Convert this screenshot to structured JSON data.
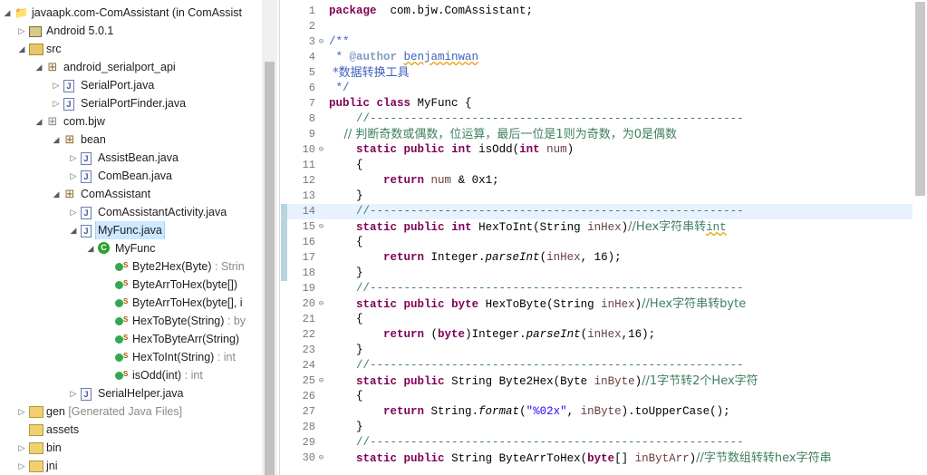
{
  "explorer": {
    "items": [
      {
        "label": "javaapk.com-ComAssistant (in ComAssist",
        "sig": "",
        "depth": 0,
        "toggle": "open",
        "icon": "project-icon"
      },
      {
        "label": "Android 5.0.1",
        "sig": "",
        "depth": 1,
        "toggle": "closed",
        "icon": "library-icon"
      },
      {
        "label": "src",
        "sig": "",
        "depth": 1,
        "toggle": "open",
        "icon": "source-folder-icon"
      },
      {
        "label": "android_serialport_api",
        "sig": "",
        "depth": 2,
        "toggle": "open",
        "icon": "package-icon"
      },
      {
        "label": "SerialPort.java",
        "sig": "",
        "depth": 3,
        "toggle": "closed",
        "icon": "java-file-icon"
      },
      {
        "label": "SerialPortFinder.java",
        "sig": "",
        "depth": 3,
        "toggle": "closed",
        "icon": "java-file-icon"
      },
      {
        "label": "com.bjw",
        "sig": "",
        "depth": 2,
        "toggle": "open",
        "icon": "empty-package-icon"
      },
      {
        "label": "bean",
        "sig": "",
        "depth": 2,
        "toggle": "open",
        "icon": "package-icon",
        "indent": 1
      },
      {
        "label": "AssistBean.java",
        "sig": "",
        "depth": 3,
        "toggle": "closed",
        "icon": "java-file-icon",
        "indent": 1
      },
      {
        "label": "ComBean.java",
        "sig": "",
        "depth": 3,
        "toggle": "closed",
        "icon": "java-file-icon",
        "indent": 1
      },
      {
        "label": "ComAssistant",
        "sig": "",
        "depth": 2,
        "toggle": "open",
        "icon": "package-icon",
        "indent": 1
      },
      {
        "label": "ComAssistantActivity.java",
        "sig": "",
        "depth": 3,
        "toggle": "closed",
        "icon": "java-file-icon",
        "indent": 1
      },
      {
        "label": "MyFunc.java",
        "sig": "",
        "depth": 3,
        "toggle": "open",
        "icon": "java-file-icon",
        "indent": 1,
        "selected": true
      },
      {
        "label": "MyFunc",
        "sig": "",
        "depth": 4,
        "toggle": "open",
        "icon": "class-icon",
        "indent": 1
      },
      {
        "label": "Byte2Hex(Byte)",
        "sig": " : Strin",
        "depth": 5,
        "toggle": "",
        "icon": "static-method-icon",
        "indent": 1
      },
      {
        "label": "ByteArrToHex(byte[])",
        "sig": "",
        "depth": 5,
        "toggle": "",
        "icon": "static-method-icon",
        "indent": 1
      },
      {
        "label": "ByteArrToHex(byte[], i",
        "sig": "",
        "depth": 5,
        "toggle": "",
        "icon": "static-method-icon",
        "indent": 1
      },
      {
        "label": "HexToByte(String)",
        "sig": " : by",
        "depth": 5,
        "toggle": "",
        "icon": "static-method-icon",
        "indent": 1
      },
      {
        "label": "HexToByteArr(String)",
        "sig": "",
        "depth": 5,
        "toggle": "",
        "icon": "static-method-icon",
        "indent": 1
      },
      {
        "label": "HexToInt(String)",
        "sig": " : int",
        "depth": 5,
        "toggle": "",
        "icon": "static-method-icon",
        "indent": 1
      },
      {
        "label": "isOdd(int)",
        "sig": " : int",
        "depth": 5,
        "toggle": "",
        "icon": "static-method-icon",
        "indent": 1
      },
      {
        "label": "SerialHelper.java",
        "sig": "",
        "depth": 3,
        "toggle": "closed",
        "icon": "java-file-icon",
        "indent": 1
      },
      {
        "label": "gen",
        "sig": " [Generated Java Files]",
        "depth": 1,
        "toggle": "closed",
        "icon": "folder-icon"
      },
      {
        "label": "assets",
        "sig": "",
        "depth": 1,
        "toggle": "",
        "icon": "folder-icon"
      },
      {
        "label": "bin",
        "sig": "",
        "depth": 1,
        "toggle": "closed",
        "icon": "folder-icon"
      },
      {
        "label": "jni",
        "sig": "",
        "depth": 1,
        "toggle": "closed",
        "icon": "folder-icon"
      }
    ]
  },
  "editor": {
    "current_line": 14,
    "lines": [
      {
        "n": "1",
        "fold": "",
        "tokens": [
          [
            "kw",
            "package"
          ],
          [
            "",
            "  com.bjw.ComAssistant;"
          ]
        ]
      },
      {
        "n": "2",
        "fold": "",
        "tokens": []
      },
      {
        "n": "3",
        "fold": "⊖",
        "tokens": [
          [
            "jd",
            "/**"
          ]
        ]
      },
      {
        "n": "4",
        "fold": "",
        "tokens": [
          [
            "jd",
            " * "
          ],
          [
            "tg",
            "@author"
          ],
          [
            "jd",
            " "
          ],
          [
            "jd sq",
            "benjaminwan"
          ]
        ]
      },
      {
        "n": "5",
        "fold": "",
        "tokens": [
          [
            "jd cjk",
            " *数据转换工具"
          ]
        ]
      },
      {
        "n": "6",
        "fold": "",
        "tokens": [
          [
            "jd",
            " */"
          ]
        ]
      },
      {
        "n": "7",
        "fold": "",
        "tokens": [
          [
            "kw",
            "public"
          ],
          [
            "",
            " "
          ],
          [
            "kw",
            "class"
          ],
          [
            "",
            " MyFunc {"
          ]
        ]
      },
      {
        "n": "8",
        "fold": "",
        "tokens": [
          [
            "cm",
            "    //-------------------------------------------------------"
          ]
        ]
      },
      {
        "n": "9",
        "fold": "",
        "tokens": [
          [
            "cm cjk",
            "    // 判断奇数或偶数，位运算，最后一位是1则为奇数，为0是偶数"
          ]
        ]
      },
      {
        "n": "10",
        "fold": "⊖",
        "tokens": [
          [
            "",
            "    "
          ],
          [
            "kw",
            "static"
          ],
          [
            "",
            " "
          ],
          [
            "kw",
            "public"
          ],
          [
            "",
            " "
          ],
          [
            "kw",
            "int"
          ],
          [
            "",
            " isOdd("
          ],
          [
            "kw",
            "int"
          ],
          [
            "",
            " "
          ],
          [
            "var",
            "num"
          ],
          [
            "",
            ")"
          ]
        ]
      },
      {
        "n": "11",
        "fold": "",
        "tokens": [
          [
            "",
            "    {"
          ]
        ]
      },
      {
        "n": "12",
        "fold": "",
        "tokens": [
          [
            "",
            "        "
          ],
          [
            "kw",
            "return"
          ],
          [
            "",
            " "
          ],
          [
            "var",
            "num"
          ],
          [
            "",
            " & 0x1;"
          ]
        ]
      },
      {
        "n": "13",
        "fold": "",
        "tokens": [
          [
            "",
            "    }"
          ]
        ]
      },
      {
        "n": "14",
        "fold": "",
        "tokens": [
          [
            "cm",
            "    //-------------------------------------------------------"
          ]
        ]
      },
      {
        "n": "15",
        "fold": "⊖",
        "tokens": [
          [
            "",
            "    "
          ],
          [
            "kw",
            "static"
          ],
          [
            "",
            " "
          ],
          [
            "kw",
            "public"
          ],
          [
            "",
            " "
          ],
          [
            "kw",
            "int"
          ],
          [
            "",
            " HexToInt(String "
          ],
          [
            "var",
            "inHex"
          ],
          [
            "",
            ")"
          ],
          [
            "cm cjk",
            "//Hex字符串转"
          ],
          [
            "cm sq",
            "int"
          ]
        ]
      },
      {
        "n": "16",
        "fold": "",
        "tokens": [
          [
            "",
            "    {"
          ]
        ]
      },
      {
        "n": "17",
        "fold": "",
        "tokens": [
          [
            "",
            "        "
          ],
          [
            "kw",
            "return"
          ],
          [
            "",
            " Integer."
          ],
          [
            "it",
            "parseInt"
          ],
          [
            "",
            "("
          ],
          [
            "var",
            "inHex"
          ],
          [
            "",
            ", 16);"
          ]
        ]
      },
      {
        "n": "18",
        "fold": "",
        "tokens": [
          [
            "",
            "    }"
          ]
        ]
      },
      {
        "n": "19",
        "fold": "",
        "tokens": [
          [
            "cm",
            "    //-------------------------------------------------------"
          ]
        ]
      },
      {
        "n": "20",
        "fold": "⊖",
        "tokens": [
          [
            "",
            "    "
          ],
          [
            "kw",
            "static"
          ],
          [
            "",
            " "
          ],
          [
            "kw",
            "public"
          ],
          [
            "",
            " "
          ],
          [
            "kw",
            "byte"
          ],
          [
            "",
            " HexToByte(String "
          ],
          [
            "var",
            "inHex"
          ],
          [
            "",
            ")"
          ],
          [
            "cm cjk",
            "//Hex字符串转byte"
          ]
        ]
      },
      {
        "n": "21",
        "fold": "",
        "tokens": [
          [
            "",
            "    {"
          ]
        ]
      },
      {
        "n": "22",
        "fold": "",
        "tokens": [
          [
            "",
            "        "
          ],
          [
            "kw",
            "return"
          ],
          [
            "",
            " ("
          ],
          [
            "kw",
            "byte"
          ],
          [
            "",
            ")Integer."
          ],
          [
            "it",
            "parseInt"
          ],
          [
            "",
            "("
          ],
          [
            "var",
            "inHex"
          ],
          [
            "",
            ",16);"
          ]
        ]
      },
      {
        "n": "23",
        "fold": "",
        "tokens": [
          [
            "",
            "    }"
          ]
        ]
      },
      {
        "n": "24",
        "fold": "",
        "tokens": [
          [
            "cm",
            "    //-------------------------------------------------------"
          ]
        ]
      },
      {
        "n": "25",
        "fold": "⊖",
        "tokens": [
          [
            "",
            "    "
          ],
          [
            "kw",
            "static"
          ],
          [
            "",
            " "
          ],
          [
            "kw",
            "public"
          ],
          [
            "",
            " String Byte2Hex(Byte "
          ],
          [
            "var",
            "inByte"
          ],
          [
            "",
            ")"
          ],
          [
            "cm cjk",
            "//1字节转2个Hex字符"
          ]
        ]
      },
      {
        "n": "26",
        "fold": "",
        "tokens": [
          [
            "",
            "    {"
          ]
        ]
      },
      {
        "n": "27",
        "fold": "",
        "tokens": [
          [
            "",
            "        "
          ],
          [
            "kw",
            "return"
          ],
          [
            "",
            " String."
          ],
          [
            "it",
            "format"
          ],
          [
            "",
            "("
          ],
          [
            "str",
            "\"%02x\""
          ],
          [
            "",
            ", "
          ],
          [
            "var",
            "inByte"
          ],
          [
            "",
            ").toUpperCase();"
          ]
        ]
      },
      {
        "n": "28",
        "fold": "",
        "tokens": [
          [
            "",
            "    }"
          ]
        ]
      },
      {
        "n": "29",
        "fold": "",
        "tokens": [
          [
            "cm",
            "    //-------------------------------------------------------"
          ]
        ]
      },
      {
        "n": "30",
        "fold": "⊖",
        "tokens": [
          [
            "",
            "    "
          ],
          [
            "kw",
            "static"
          ],
          [
            "",
            " "
          ],
          [
            "kw",
            "public"
          ],
          [
            "",
            " String ByteArrToHex("
          ],
          [
            "kw",
            "byte"
          ],
          [
            "",
            "[] "
          ],
          [
            "var",
            "inBytArr"
          ],
          [
            "",
            ")"
          ],
          [
            "cm cjk",
            "//字节数组转转hex字符串"
          ]
        ]
      }
    ]
  },
  "colors": {
    "selection": "#cde8ff",
    "current_line": "#e8f2fe",
    "keyword": "#7f0055",
    "comment": "#3f7f5f",
    "javadoc": "#3f5fbf",
    "string": "#2a00ff",
    "variable": "#6a3e3e"
  }
}
